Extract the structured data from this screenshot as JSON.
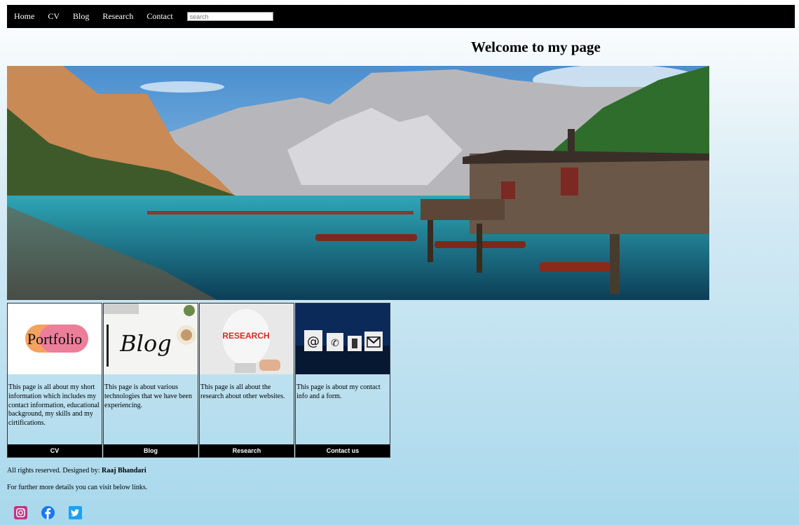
{
  "nav": {
    "items": [
      "Home",
      "CV",
      "Blog",
      "Research",
      "Contact"
    ],
    "search_placeholder": "search"
  },
  "title": "Welcome to my page",
  "cards": [
    {
      "image_text": "Portfolio",
      "text": "This page is all about my short information which includes my contact information, educational background, my skills and my cirtifications.",
      "button": "CV"
    },
    {
      "image_text": "Blog",
      "text": "This page is about various technologies that we have been experiencing.",
      "button": "Blog"
    },
    {
      "image_text": "RESEARCH",
      "text": "This page is all about the research about other websites.",
      "button": "Research"
    },
    {
      "image_text": "",
      "text": "This page is about my contact info and a form.",
      "button": "Contact us"
    }
  ],
  "footer": {
    "rights": "All rights reserved. Designed by: ",
    "author": "Raaj Bhandari",
    "details": "For further more details you can visit below links."
  },
  "socials": [
    "instagram-icon",
    "facebook-icon",
    "twitter-icon"
  ],
  "colors": {
    "instagram": "#c13584",
    "facebook": "#1877f2",
    "twitter": "#1da1f2"
  }
}
